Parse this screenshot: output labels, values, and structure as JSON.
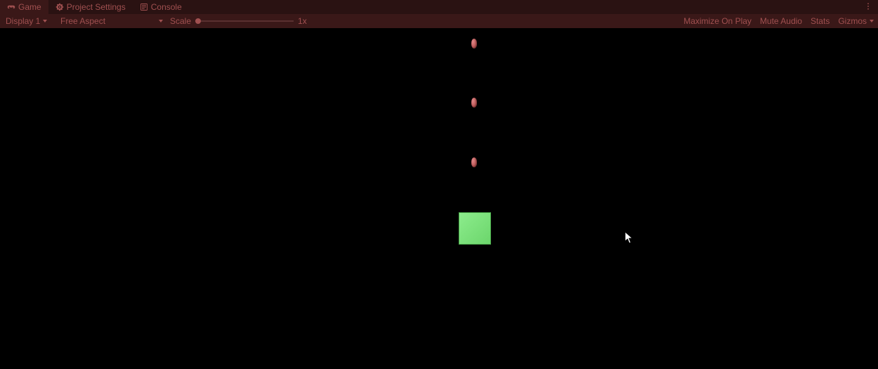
{
  "tabs": {
    "game": "Game",
    "project_settings": "Project Settings",
    "console": "Console"
  },
  "toolbar": {
    "display": "Display 1",
    "aspect": "Free Aspect",
    "scale_label": "Scale",
    "scale_value": "1x",
    "maximize": "Maximize On Play",
    "mute": "Mute Audio",
    "stats": "Stats",
    "gizmos": "Gizmos"
  },
  "icons": {
    "game": "gamepad-icon",
    "settings": "gear-icon",
    "console": "console-icon",
    "kebab": "kebab-icon"
  }
}
